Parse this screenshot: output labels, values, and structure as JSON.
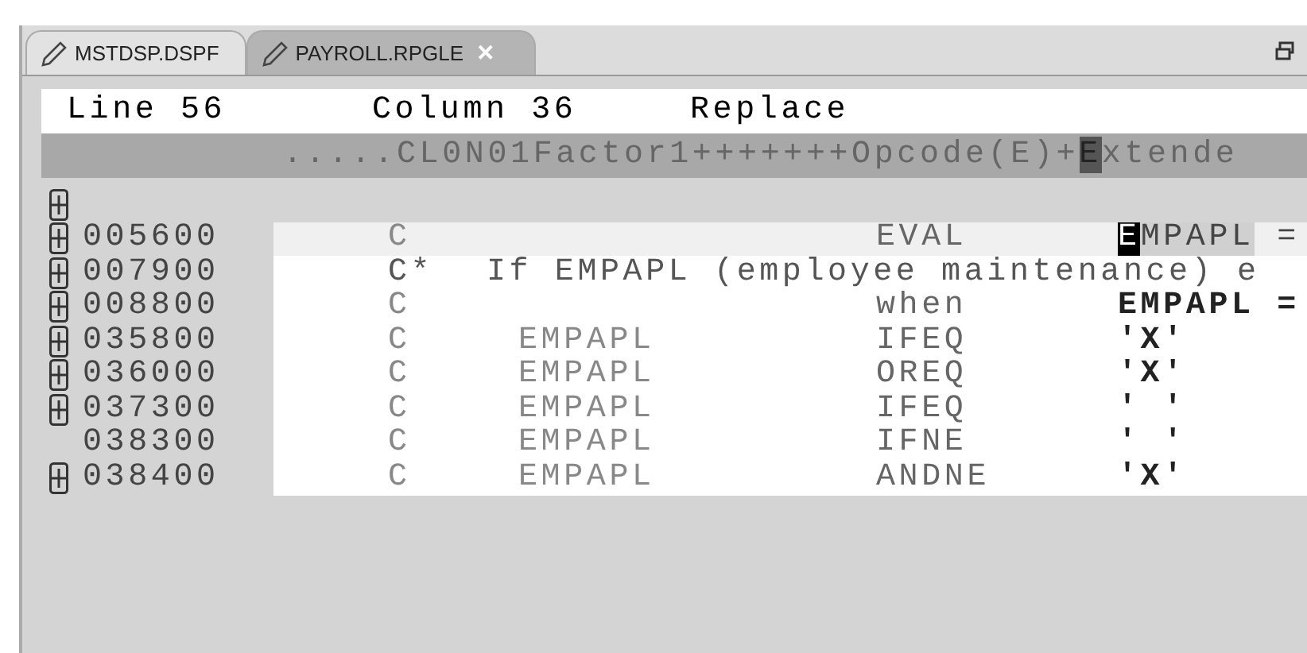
{
  "tabs": [
    {
      "label": "MSTDSP.DSPF",
      "selected": false,
      "closable": false
    },
    {
      "label": "PAYROLL.RPGLE",
      "selected": true,
      "closable": true
    }
  ],
  "close_glyph": "✕",
  "status": {
    "line": "Line 56",
    "column": "Column 36",
    "mode": "Replace"
  },
  "ruler": {
    "before": ".....CL0N01Factor1+++++++Opcode(E)+",
    "cursor": "E",
    "after": "xtende"
  },
  "top_fold_expandable": true,
  "rows": [
    {
      "seq": "005600",
      "kind": "calc",
      "expandable": true,
      "current": true,
      "spec": "C",
      "factor1": "",
      "opcode": "EVAL",
      "factor2_cursor": "E",
      "factor2": "MPAPL",
      "factor2_rest": " ="
    },
    {
      "seq": "007900",
      "kind": "comment",
      "expandable": true,
      "current": false,
      "spec": "C*",
      "comment": "If EMPAPL (employee maintenance) e"
    },
    {
      "seq": "008800",
      "kind": "calc",
      "expandable": true,
      "current": false,
      "spec": "C",
      "factor1": "",
      "opcode": "when",
      "factor2": "EMPAPL =",
      "bold": true
    },
    {
      "seq": "035800",
      "kind": "calc",
      "expandable": true,
      "current": false,
      "spec": "C",
      "factor1": "EMPAPL",
      "opcode": "IFEQ",
      "factor2": "'X'",
      "bold": true
    },
    {
      "seq": "036000",
      "kind": "calc",
      "expandable": true,
      "current": false,
      "spec": "C",
      "factor1": "EMPAPL",
      "opcode": "OREQ",
      "factor2": "'X'",
      "bold": true
    },
    {
      "seq": "037300",
      "kind": "calc",
      "expandable": true,
      "current": false,
      "spec": "C",
      "factor1": "EMPAPL",
      "opcode": "IFEQ",
      "factor2": "' '",
      "bold": true
    },
    {
      "seq": "038300",
      "kind": "calc",
      "expandable": false,
      "current": false,
      "spec": "C",
      "factor1": "EMPAPL",
      "opcode": "IFNE",
      "factor2": "' '",
      "bold": true
    },
    {
      "seq": "038400",
      "kind": "calc",
      "expandable": true,
      "current": false,
      "spec": "C",
      "factor1": "EMPAPL",
      "opcode": "ANDNE",
      "factor2": "'X'",
      "bold": true
    }
  ]
}
